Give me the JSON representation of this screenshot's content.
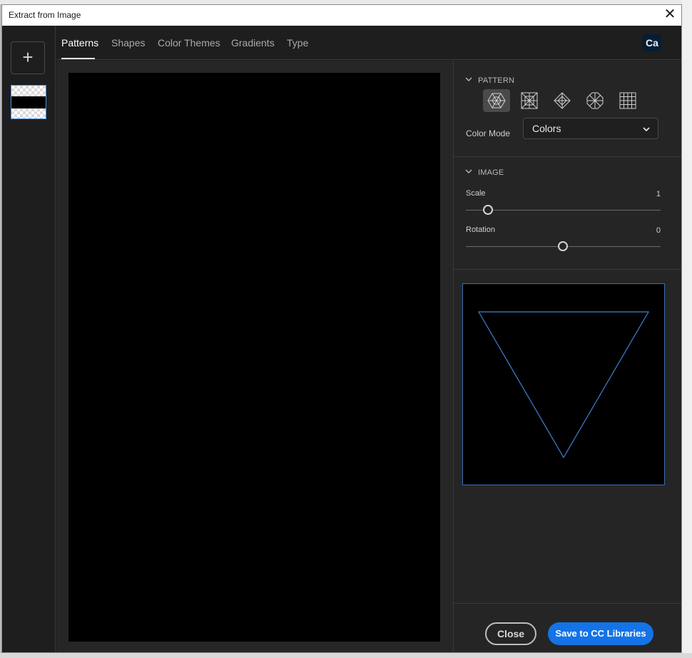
{
  "window": {
    "title": "Extract from Image",
    "close_glyph": "✕"
  },
  "leftrail": {
    "add_glyph": "+"
  },
  "tabs": [
    {
      "label": "Patterns",
      "active": true
    },
    {
      "label": "Shapes"
    },
    {
      "label": "Color Themes"
    },
    {
      "label": "Gradients"
    },
    {
      "label": "Type"
    }
  ],
  "badge": "Ca",
  "pattern": {
    "heading": "PATTERN",
    "icons": [
      "hexagon-pattern-icon",
      "square-pattern-icon",
      "diamond-pattern-icon",
      "octagon-pattern-icon",
      "grid-pattern-icon"
    ],
    "color_mode_label": "Color Mode",
    "color_mode_value": "Colors"
  },
  "image": {
    "heading": "IMAGE",
    "scale_label": "Scale",
    "scale_value": "1",
    "rotation_label": "Rotation",
    "rotation_value": "0"
  },
  "buttons": {
    "close": "Close",
    "save": "Save to CC Libraries"
  },
  "colors": {
    "accent": "#1473e6",
    "preview_stroke": "#3f7fcf"
  }
}
